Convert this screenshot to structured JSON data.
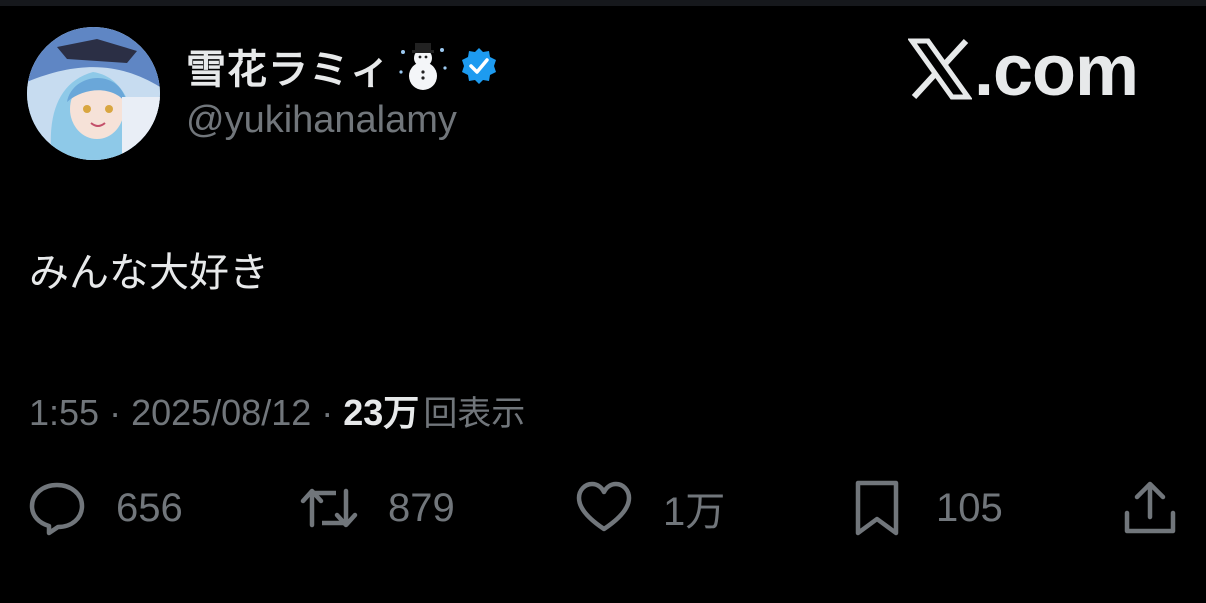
{
  "author": {
    "display_name": "雪花ラミィ",
    "handle": "@yukihanalamy"
  },
  "brand": {
    "text": ".com"
  },
  "tweet": {
    "text": "みんな大好き"
  },
  "meta": {
    "time": "1:55",
    "separator": "·",
    "date": "2025/08/12",
    "views_count": "23万",
    "views_label": "回表示"
  },
  "actions": {
    "reply_count": "656",
    "retweet_count": "879",
    "like_count": "1万",
    "bookmark_count": "105"
  },
  "colors": {
    "background": "#000000",
    "text": "#e7e9ea",
    "muted": "#71767b",
    "verified": "#1d9bf0"
  },
  "icons": [
    "avatar",
    "snowman-emoji-icon",
    "verified-badge-icon",
    "x-logo-icon",
    "reply-icon",
    "retweet-icon",
    "like-icon",
    "bookmark-icon",
    "share-icon"
  ]
}
